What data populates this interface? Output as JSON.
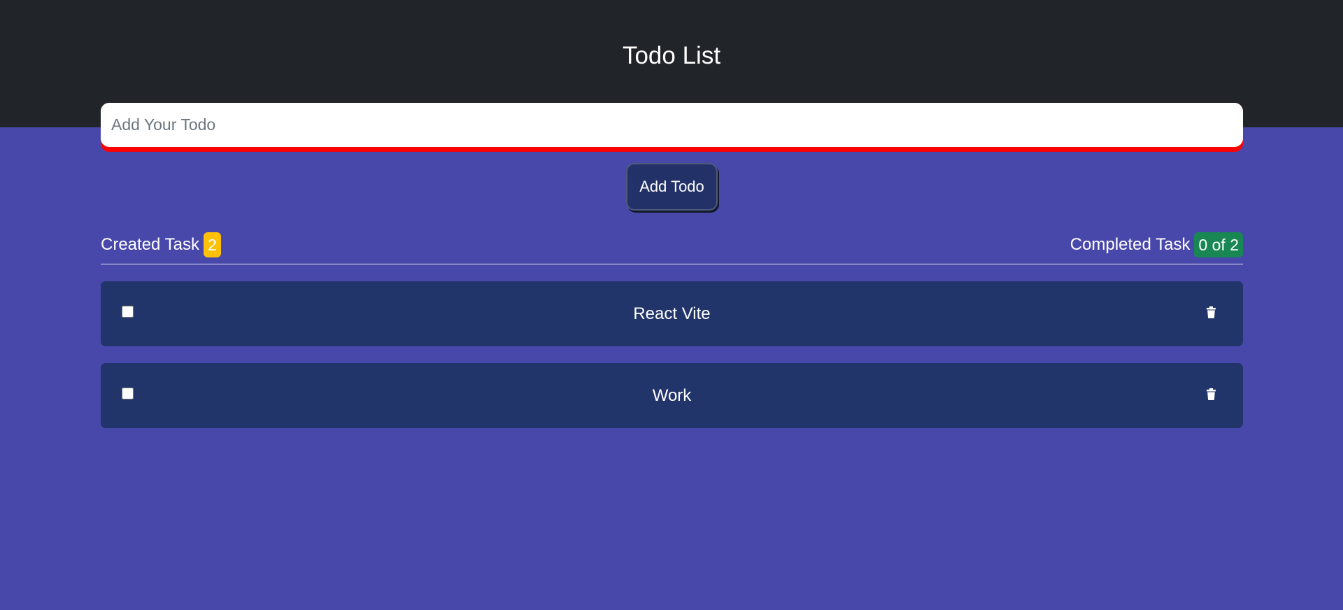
{
  "header": {
    "title": "Todo List"
  },
  "form": {
    "input_value": "",
    "input_placeholder": "Add Your Todo",
    "add_button_label": "Add Todo"
  },
  "stats": {
    "created_label": "Created Task",
    "created_count": "2",
    "completed_label": "Completed Task",
    "completed_count": "0 of 2"
  },
  "todos": [
    {
      "text": "React Vite",
      "checked": false,
      "delete_icon": "trash-icon"
    },
    {
      "text": "Work",
      "checked": false,
      "delete_icon": "trash-icon"
    }
  ],
  "colors": {
    "page_background": "#4848ab",
    "header_background": "#212529",
    "input_underline": "#ff0000",
    "button_background": "#223168",
    "todo_item_background": "#22356b",
    "created_badge": "#ffc107",
    "completed_badge": "#198754"
  }
}
